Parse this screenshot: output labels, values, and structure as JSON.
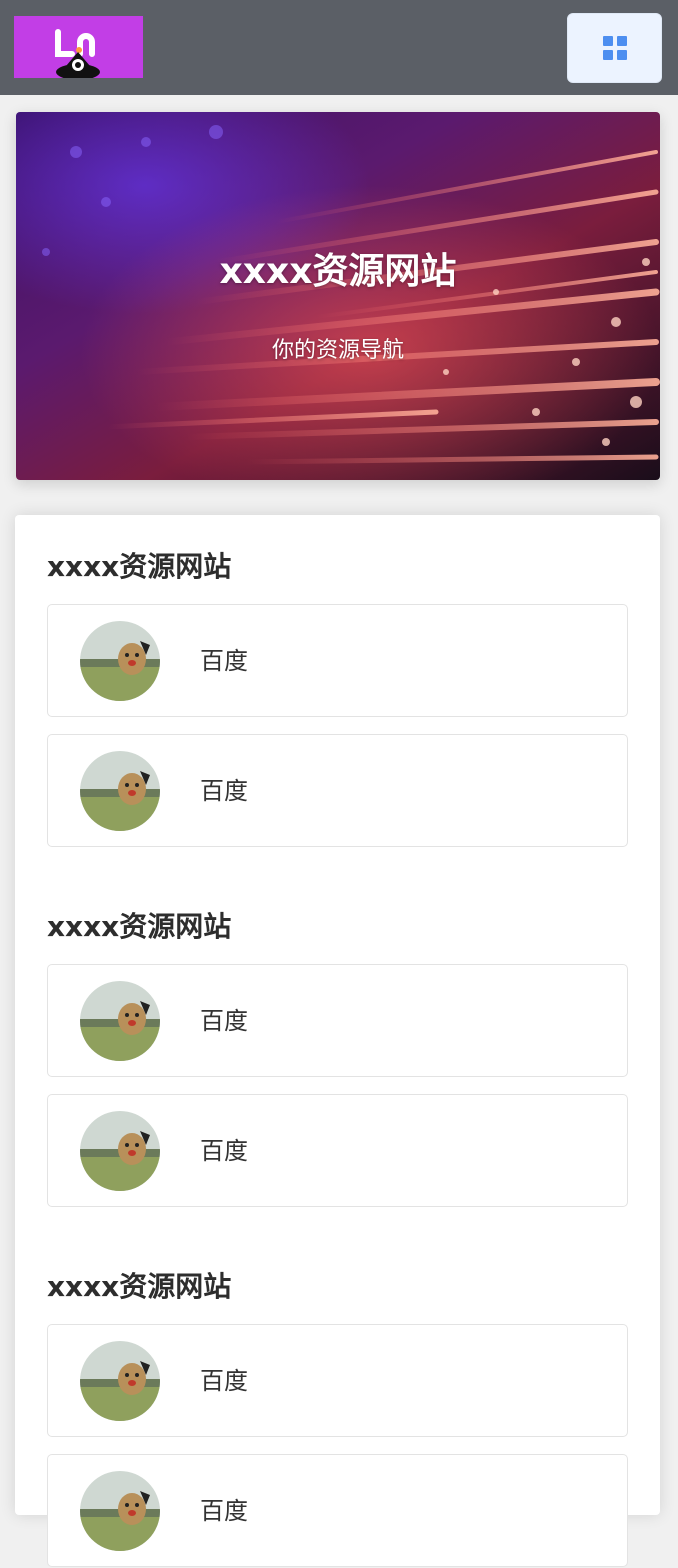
{
  "header": {
    "logo_text": "Ln",
    "menu_icon": "grid-icon"
  },
  "hero": {
    "title": "xxxx资源网站",
    "subtitle": "你的资源导航"
  },
  "sections": [
    {
      "title": "xxxx资源网站",
      "items": [
        {
          "label": "百度"
        },
        {
          "label": "百度"
        }
      ]
    },
    {
      "title": "xxxx资源网站",
      "items": [
        {
          "label": "百度"
        },
        {
          "label": "百度"
        }
      ]
    },
    {
      "title": "xxxx资源网站",
      "items": [
        {
          "label": "百度"
        },
        {
          "label": "百度"
        }
      ]
    }
  ],
  "colors": {
    "topbar": "#5b5f66",
    "logo_bg": "#c23ee6",
    "menu_button": "#ecf3ff",
    "menu_icon": "#4d8ef0"
  }
}
